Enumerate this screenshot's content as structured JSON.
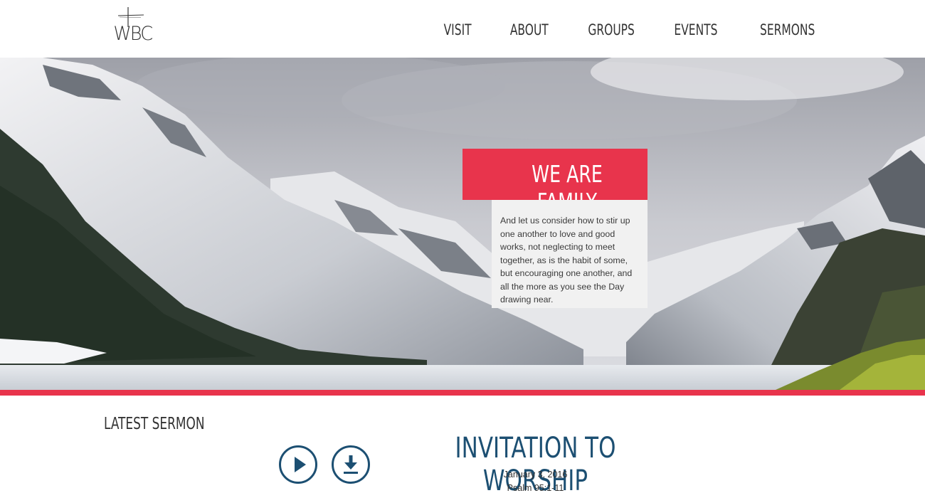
{
  "header": {
    "logo_text": "WBC",
    "nav": [
      "VISIT",
      "ABOUT",
      "GROUPS",
      "EVENTS",
      "SERMONS"
    ]
  },
  "hero": {
    "tagline": "WE ARE FAMILY",
    "verse": "And let us consider how to stir up one another to love and good works, not neglecting to meet together, as is the habit of some, but encouraging one another, and all the more as you see the Day drawing near."
  },
  "latest_sermon": {
    "section_label": "LATEST SERMON",
    "title": "INVITATION TO WORSHIP",
    "date": "January 3, 2016",
    "reference": "Psalm 95:1-11",
    "play_icon": "play-icon",
    "download_icon": "download-icon"
  },
  "colors": {
    "accent": "#e8344c",
    "brand_blue": "#1c4f72",
    "text": "#333333"
  }
}
